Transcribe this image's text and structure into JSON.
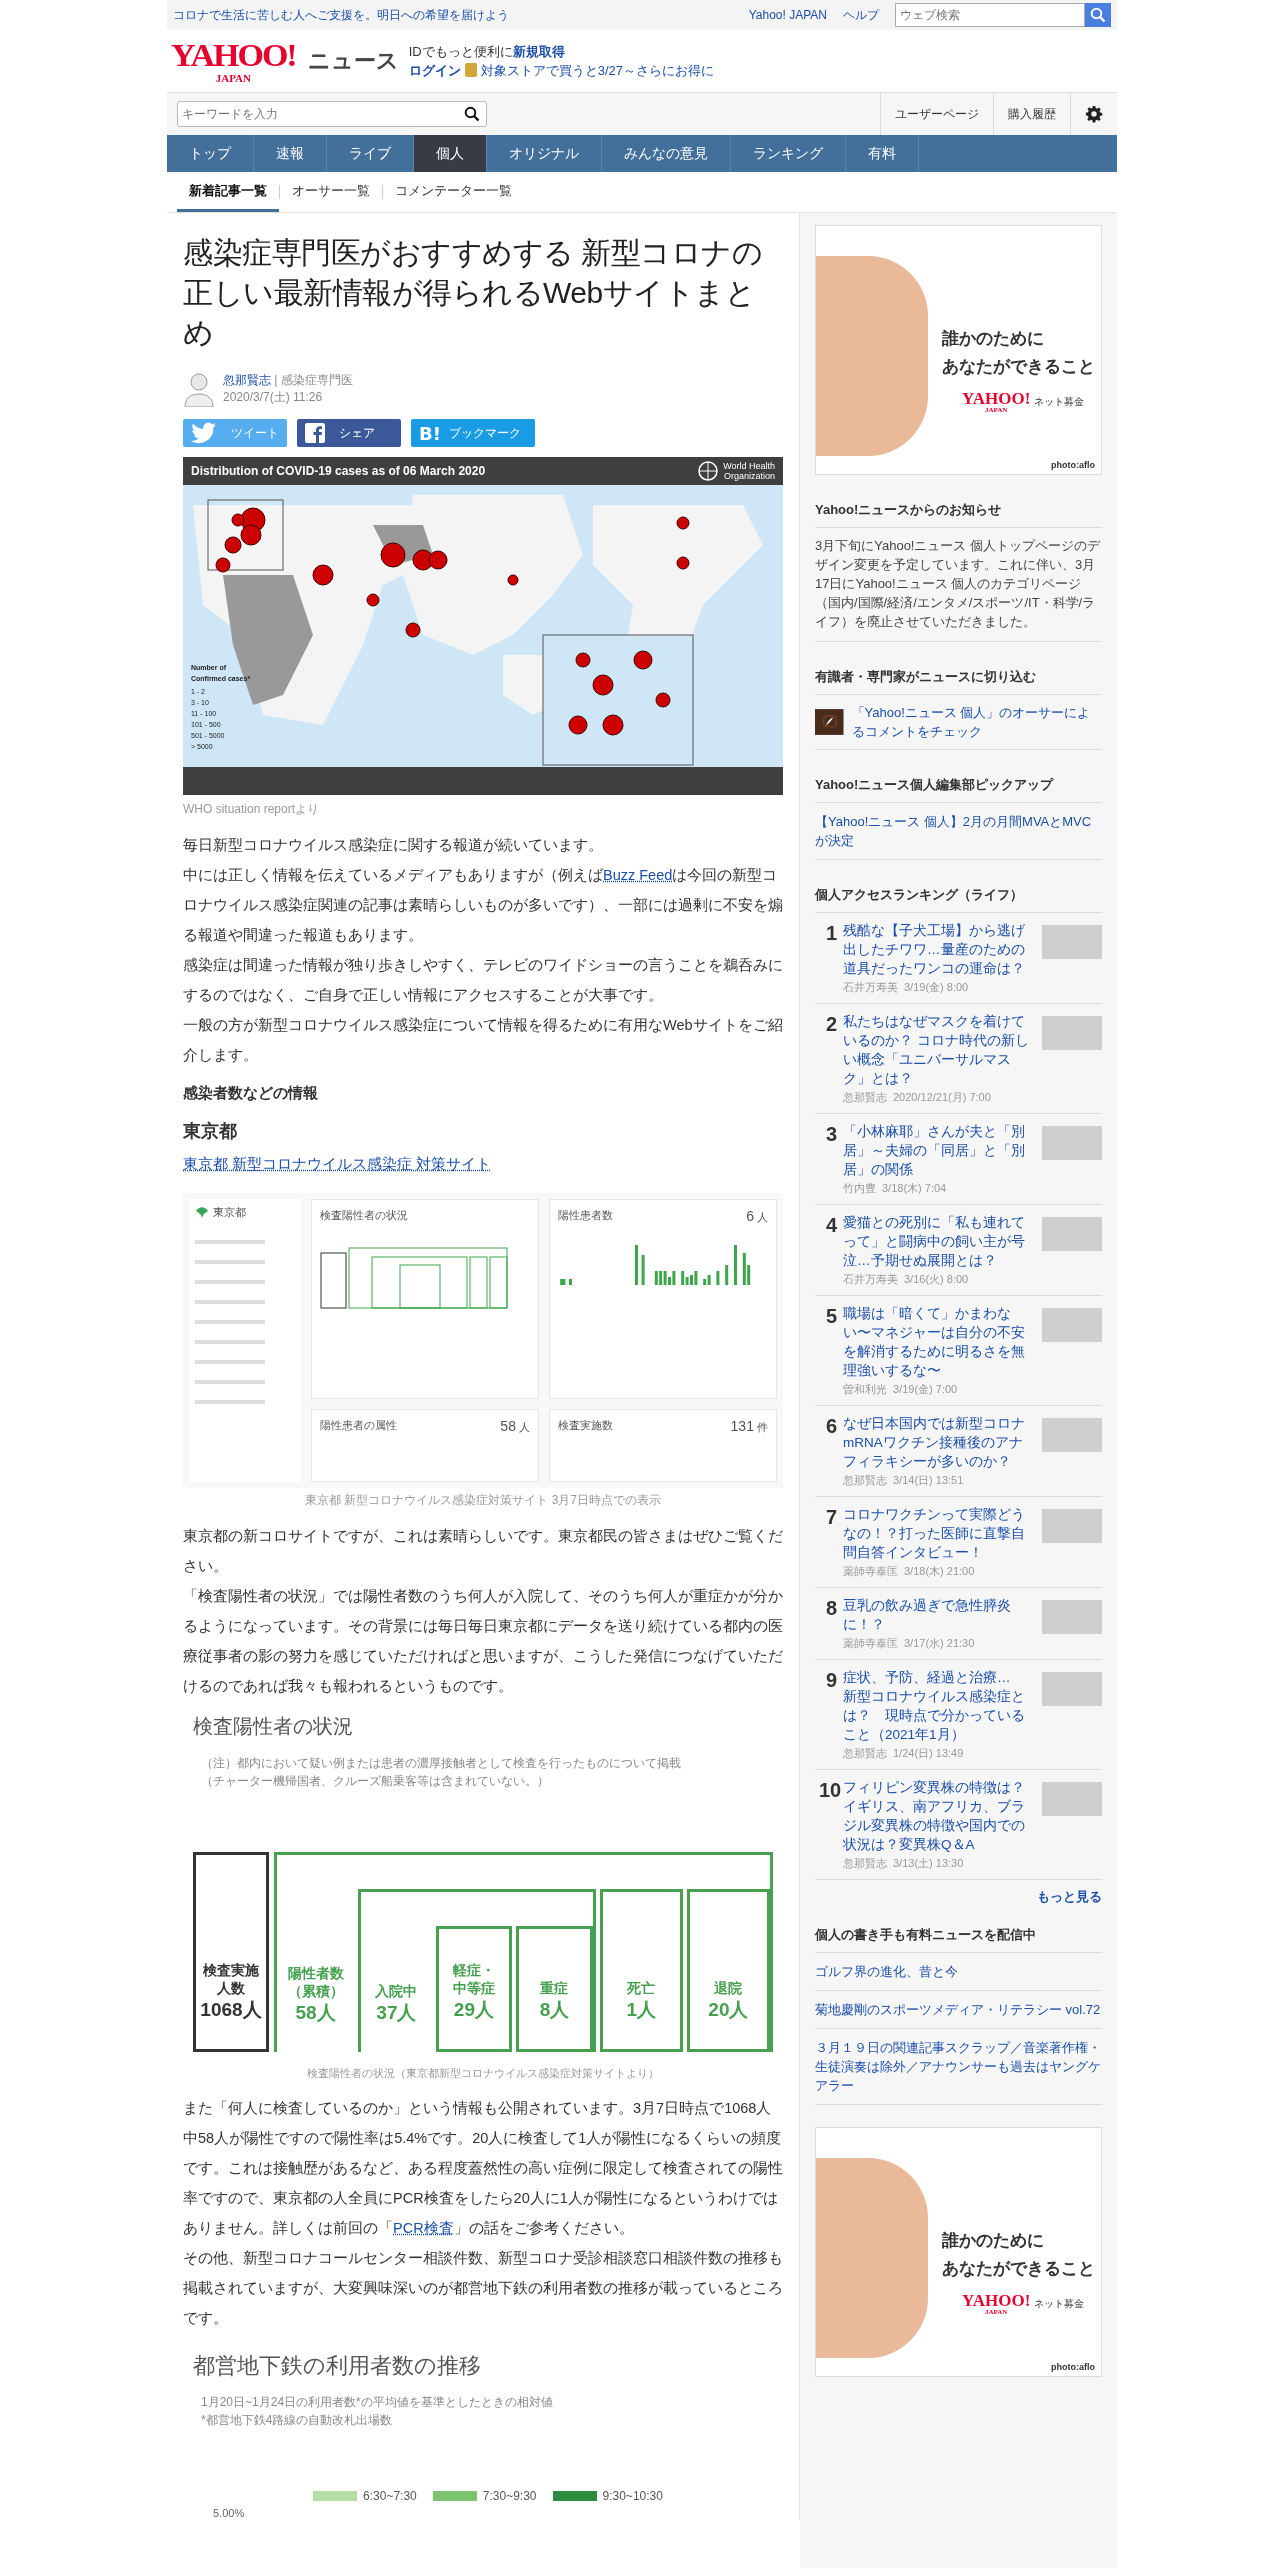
{
  "top_bar": {
    "message": "コロナで生活に苦しむ人へご支援を。明日への希望を届けよう",
    "links": [
      "Yahoo! JAPAN",
      "ヘルプ"
    ],
    "search": {
      "placeholder": "ウェブ検索"
    }
  },
  "header": {
    "logo": "YAHOO!",
    "logo_sub": "JAPAN",
    "service": "ニュース",
    "promo_text": "IDでもっと便利に",
    "signup": "新規取得",
    "login": "ログイン",
    "promo_link": "対象ストアで買うと3/27～さらにお得に"
  },
  "toolbar": {
    "search": {
      "placeholder": "キーワードを入力"
    },
    "links": [
      "ユーザーページ",
      "購入履歴"
    ]
  },
  "nav": [
    {
      "label": "トップ",
      "selected": false
    },
    {
      "label": "速報",
      "selected": false
    },
    {
      "label": "ライブ",
      "selected": false
    },
    {
      "label": "個人",
      "selected": true
    },
    {
      "label": "オリジナル",
      "selected": false
    },
    {
      "label": "みんなの意見",
      "selected": false
    },
    {
      "label": "ランキング",
      "selected": false
    },
    {
      "label": "有料",
      "selected": false
    }
  ],
  "subnav": [
    {
      "label": "新着記事一覧",
      "selected": true
    },
    {
      "label": "オーサー一覧",
      "selected": false
    },
    {
      "label": "コメンテーター一覧",
      "selected": false
    }
  ],
  "article": {
    "title": "感染症専門医がおすすめする 新型コロナの正しい最新情報が得られるWebサイトまとめ",
    "author": {
      "name": "忽那賢志",
      "separator": "|",
      "role": "感染症専門医",
      "date": "2020/3/7(土) 11:26"
    },
    "share": [
      {
        "kind": "twitter",
        "label": "ツイート"
      },
      {
        "kind": "facebook",
        "label": "シェア"
      },
      {
        "kind": "hatena",
        "label": "ブックマーク",
        "icon_text": "B!"
      }
    ],
    "map": {
      "title": "Distribution of COVID-19 cases as of 06 March 2020",
      "org": [
        "World Health",
        "Organization"
      ],
      "legend_title": "Number of Confirmed cases*",
      "legend": [
        "1 - 2",
        "3 - 10",
        "11 - 100",
        "101 - 500",
        "501 - 5000",
        "> 5000"
      ],
      "caption": "WHO situation reportより"
    },
    "blocks": [
      {
        "kind": "paragraph",
        "text": "毎日新型コロナウイルス感染症に関する報道が続いています。"
      },
      {
        "kind": "paragraph",
        "text": "中には正しく情報を伝えているメディアもありますが（例えば",
        "link": "Buzz Feed",
        "after": "は今回の新型コロナウイルス感染症関連の記事は素晴らしいものが多いです）、一部には過剰に不安を煽る報道や間違った報道もあります。"
      },
      {
        "kind": "paragraph",
        "text": "感染症は間違った情報が独り歩きしやすく、テレビのワイドショーの言うことを鵜呑みにするのではなく、ご自身で正しい情報にアクセスすることが大事です。"
      },
      {
        "kind": "paragraph",
        "text": "一般の方が新型コロナウイルス感染症について情報を得るために有用なWebサイトをご紹介します。"
      },
      {
        "kind": "subheading",
        "text": "感染者数などの情報"
      },
      {
        "kind": "heading",
        "text": "東京都"
      },
      {
        "kind": "link",
        "text": "東京都 新型コロナウイルス感染症 対策サイト"
      },
      {
        "kind": "site_screenshot",
        "site_name": "東京都",
        "cards": [
          {
            "title": "検査陽性者の状況"
          },
          {
            "title": "陽性患者数",
            "value": "6",
            "unit": "人"
          },
          {
            "title": "陽性患者の属性",
            "value": "58",
            "unit": "人"
          },
          {
            "title": "検査実施数",
            "value": "131",
            "unit": "件"
          }
        ],
        "caption": "東京都 新型コロナウイルス感染症対策サイト 3月7日時点での表示"
      },
      {
        "kind": "paragraph",
        "text": "東京都の新コロサイトですが、これは素晴らしいです。東京都民の皆さまはぜひご覧ください。"
      },
      {
        "kind": "paragraph",
        "text": "「検査陽性者の状況」では陽性者数のうち何人が入院して、そのうち何人が重症かが分かるようになっています。その背景には毎日毎日東京都にデータを送り続けている都内の医療従事者の影の努力を感じていただければと思いますが、こうした発信につなげていただけるのであれば我々も報われるというものです。"
      },
      {
        "kind": "status_figure",
        "title": "検査陽性者の状況",
        "notes": [
          "（注）都内において疑い例または患者の濃厚接触者として検査を行ったものについて掲載",
          "（チャーター機帰国者、クルーズ船乗客等は含まれていない。）"
        ],
        "total": {
          "label_lines": [
            "検査実施",
            "人数"
          ],
          "value": "1068人"
        },
        "tree": {
          "label_lines": [
            "陽性者数",
            "（累積）"
          ],
          "value": "58人",
          "children": [
            {
              "label_lines": [
                "入院中"
              ],
              "value": "37人",
              "children": [
                {
                  "label_lines": [
                    "軽症・",
                    "中等症"
                  ],
                  "value": "29人"
                },
                {
                  "label_lines": [
                    "重症"
                  ],
                  "value": "8人"
                }
              ]
            },
            {
              "label_lines": [
                "死亡"
              ],
              "value": "1人"
            },
            {
              "label_lines": [
                "退院"
              ],
              "value": "20人"
            }
          ]
        },
        "caption": "検査陽性者の状況（東京都新型コロナウイルス感染症対策サイトより）"
      },
      {
        "kind": "paragraph",
        "text": "また「何人に検査しているのか」という情報も公開されています。3月7日時点で1068人中58人が陽性ですので陽性率は5.4%です。20人に検査して1人が陽性になるくらいの頻度です。これは接触歴があるなど、ある程度蓋然性の高い症例に限定して検査されての陽性率ですので、東京都の人全員にPCR検査をしたら20人に1人が陽性になるというわけではありません。詳しくは前回の「",
        "link": "PCR検査",
        "after": "」の話をご参考ください。"
      },
      {
        "kind": "paragraph",
        "text": "その他、新型コロナコールセンター相談件数、新型コロナ受診相談窓口相談件数の推移も掲載されていますが、大変興味深いのが都営地下鉄の利用者数の推移が載っているところです。"
      },
      {
        "kind": "subway_figure",
        "title": "都営地下鉄の利用者数の推移",
        "notes": [
          "1月20日~1月24日の利用者数*の平均値を基準としたときの相対値",
          "*都営地下鉄4路線の自動改札出場数"
        ],
        "legend": [
          {
            "label": "6:30~7:30",
            "color": "#b4dea4"
          },
          {
            "label": "7:30~9:30",
            "color": "#7cc46e"
          },
          {
            "label": "9:30~10:30",
            "color": "#2e8b3e"
          }
        ],
        "axis_label": "5.00%"
      }
    ]
  },
  "sidebar": {
    "ads": [
      {
        "headline_lines": [
          "誰かのために",
          "あなたができること"
        ],
        "logo": "YAHOO!",
        "logo_sub": "JAPAN",
        "service": "ネット募金",
        "credit": "photo:aflo"
      },
      {
        "headline_lines": [
          "誰かのために",
          "あなたができること"
        ],
        "logo": "YAHOO!",
        "logo_sub": "JAPAN",
        "service": "ネット募金",
        "credit": "photo:aflo"
      }
    ],
    "notice": {
      "heading": "Yahoo!ニュースからのお知らせ",
      "text": "3月下旬にYahoo!ニュース 個人トップページのデザイン変更を予定しています。これに伴い、3月17日にYahoo!ニュース 個人のカテゴリページ（国内/国際/経済/エンタメ/スポーツ/IT・科学/ライフ）を廃止させていただきました。"
    },
    "experts": {
      "heading": "有識者・専門家がニュースに切り込む",
      "link": "「Yahoo!ニュース 個人」のオーサーによるコメントをチェック"
    },
    "pickup": {
      "heading": "Yahoo!ニュース個人編集部ピックアップ",
      "link": "【Yahoo!ニュース 個人】2月の月間MVAとMVCが決定"
    },
    "ranking": {
      "heading": "個人アクセスランキング（ライフ）",
      "items": [
        {
          "rank": "1",
          "title": "残酷な【子犬工場】から逃げ出したチワワ…量産のための道具だったワンコの運命は？",
          "author": "石井万寿美",
          "date": "3/19(金) 8:00"
        },
        {
          "rank": "2",
          "title": "私たちはなぜマスクを着けているのか？ コロナ時代の新しい概念「ユニバーサルマスク」とは？",
          "author": "忽那賢志",
          "date": "2020/12/21(月) 7:00"
        },
        {
          "rank": "3",
          "title": "「小林麻耶」さんが夫と「別居」～夫婦の「同居」と「別居」の関係",
          "author": "竹内豊",
          "date": "3/18(木) 7:04"
        },
        {
          "rank": "4",
          "title": "愛猫との死別に「私も連れてって」と闘病中の飼い主が号泣…予期せぬ展開とは？",
          "author": "石井万寿美",
          "date": "3/16(火) 8:00"
        },
        {
          "rank": "5",
          "title": "職場は「暗くて」かまわない〜マネジャーは自分の不安を解消するために明るさを無理強いするな〜",
          "author": "曽和利光",
          "date": "3/19(金) 7:00"
        },
        {
          "rank": "6",
          "title": "なぜ日本国内では新型コロナmRNAワクチン接種後のアナフィラキシーが多いのか？",
          "author": "忽那賢志",
          "date": "3/14(日) 13:51"
        },
        {
          "rank": "7",
          "title": "コロナワクチンって実際どうなの！？打った医師に直撃自問自答インタビュー！",
          "author": "薬師寺泰匡",
          "date": "3/18(木) 21:00"
        },
        {
          "rank": "8",
          "title": "豆乳の飲み過ぎで急性膵炎に！？",
          "author": "薬師寺泰匡",
          "date": "3/17(水) 21:30"
        },
        {
          "rank": "9",
          "title": "症状、予防、経過と治療…　新型コロナウイルス感染症とは？　現時点で分かっていること（2021年1月）",
          "author": "忽那賢志",
          "date": "1/24(日) 13:49"
        },
        {
          "rank": "10",
          "title": "フィリピン変異株の特徴は？イギリス、南アフリカ、ブラジル変異株の特徴や国内での状況は？変異株Q＆A",
          "author": "忽那賢志",
          "date": "3/13(土) 13:30"
        }
      ],
      "more": "もっと見る"
    },
    "paid": {
      "heading": "個人の書き手も有料ニュースを配信中",
      "links": [
        "ゴルフ界の進化、昔と今",
        "菊地慶剛のスポーツメディア・リテラシー vol.72",
        "３月１９日の関連記事スクラップ／音楽著作権・生徒演奏は除外／アナウンサーも過去はヤングケアラー"
      ]
    }
  }
}
